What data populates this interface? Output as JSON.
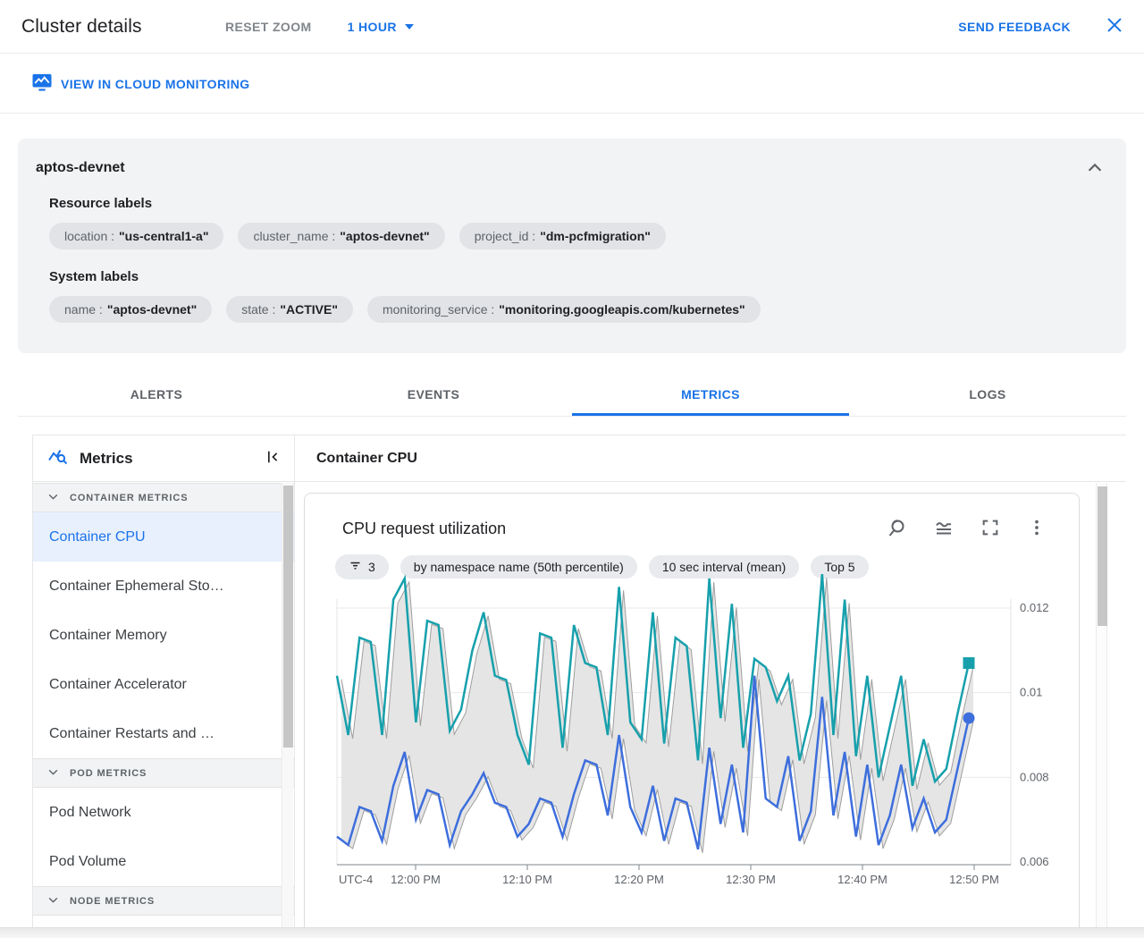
{
  "header": {
    "title": "Cluster details",
    "reset_zoom_label": "RESET ZOOM",
    "time_range_label": "1 HOUR",
    "send_feedback_label": "SEND FEEDBACK"
  },
  "toolbar": {
    "view_in_monitoring_label": "VIEW IN CLOUD MONITORING"
  },
  "cluster_panel": {
    "name": "aptos-devnet",
    "resource_labels_title": "Resource labels",
    "resource_labels": [
      {
        "key": "location :",
        "value": "\"us-central1-a\""
      },
      {
        "key": "cluster_name :",
        "value": "\"aptos-devnet\""
      },
      {
        "key": "project_id :",
        "value": "\"dm-pcfmigration\""
      }
    ],
    "system_labels_title": "System labels",
    "system_labels": [
      {
        "key": "name :",
        "value": "\"aptos-devnet\""
      },
      {
        "key": "state :",
        "value": "\"ACTIVE\""
      },
      {
        "key": "monitoring_service :",
        "value": "\"monitoring.googleapis.com/kubernetes\""
      }
    ]
  },
  "tabs": [
    {
      "label": "ALERTS",
      "active": false
    },
    {
      "label": "EVENTS",
      "active": false
    },
    {
      "label": "METRICS",
      "active": true
    },
    {
      "label": "LOGS",
      "active": false
    }
  ],
  "sidebar": {
    "title": "Metrics",
    "groups": [
      {
        "header": "CONTAINER METRICS",
        "items": [
          {
            "label": "Container CPU",
            "selected": true
          },
          {
            "label": "Container Ephemeral Sto…",
            "selected": false
          },
          {
            "label": "Container Memory",
            "selected": false
          },
          {
            "label": "Container Accelerator",
            "selected": false
          },
          {
            "label": "Container Restarts and …",
            "selected": false
          }
        ]
      },
      {
        "header": "POD METRICS",
        "items": [
          {
            "label": "Pod Network",
            "selected": false
          },
          {
            "label": "Pod Volume",
            "selected": false
          }
        ]
      },
      {
        "header": "NODE METRICS",
        "items": []
      }
    ]
  },
  "main": {
    "section_title": "Container CPU"
  },
  "chart_card": {
    "title": "CPU request utilization",
    "filter_count": "3",
    "chips": [
      "by namespace name (50th percentile)",
      "10 sec interval (mean)",
      "Top 5"
    ]
  },
  "colors": {
    "accent": "#1A73E8",
    "series_teal": "#17A0AC",
    "series_blue": "#3D6EDC",
    "band_fill": "#E5E5E5",
    "band_stroke": "#9E9E9E",
    "grid": "#E8EAED",
    "axis": "#80868B"
  },
  "icons": {
    "monitoring-chart-icon": "monitor with waveform",
    "metrics-search-icon": "zigzag line with magnifier",
    "collapse-panel-icon": "bar with left chevron",
    "chevron-down-icon": "v chevron",
    "chevron-up-icon": "^ chevron",
    "filter-icon": "tapered filter lines",
    "zoom-reset-icon": "magnifier",
    "chart-options-icon": "wave over lines",
    "fullscreen-icon": "corner brackets",
    "more-vert-icon": "kebab dots",
    "close-icon": "x"
  },
  "chart_data": {
    "type": "line",
    "title": "CPU request utilization",
    "timezone_label": "UTC-4",
    "x_tick_labels": [
      "12:00 PM",
      "12:10 PM",
      "12:20 PM",
      "12:30 PM",
      "12:40 PM",
      "12:50 PM"
    ],
    "y_ticks": [
      0.006,
      0.008,
      0.01,
      0.012
    ],
    "y_tick_labels": [
      "0.006",
      "0.008",
      "0.01",
      "0.012"
    ],
    "ylim": [
      0.006,
      0.0129
    ],
    "grid": true,
    "legend": false,
    "series": [
      {
        "id": "series-teal-50th-percentile",
        "color": "#17A0AC",
        "marker": "square",
        "values": [
          0.0104,
          0.009,
          0.0113,
          0.0112,
          0.009,
          0.0122,
          0.0127,
          0.0093,
          0.0117,
          0.0116,
          0.0091,
          0.0096,
          0.011,
          0.0119,
          0.0104,
          0.0103,
          0.009,
          0.0083,
          0.0114,
          0.0113,
          0.0087,
          0.0116,
          0.0107,
          0.0106,
          0.009,
          0.0125,
          0.0093,
          0.0089,
          0.0119,
          0.0088,
          0.0113,
          0.0111,
          0.0084,
          0.0127,
          0.0094,
          0.0121,
          0.0087,
          0.0108,
          0.0106,
          0.0098,
          0.0104,
          0.0084,
          0.0095,
          0.0128,
          0.009,
          0.0122,
          0.0085,
          0.0104,
          0.008,
          0.0092,
          0.0104,
          0.0078,
          0.0089,
          0.0079,
          0.0082,
          0.0095,
          0.0107
        ]
      },
      {
        "id": "series-blue-50th-percentile",
        "color": "#3D6EDC",
        "marker": "circle",
        "values": [
          0.0066,
          0.0064,
          0.0073,
          0.0072,
          0.0065,
          0.0078,
          0.0086,
          0.007,
          0.0077,
          0.0076,
          0.0064,
          0.0072,
          0.0076,
          0.0081,
          0.0074,
          0.0073,
          0.0066,
          0.0069,
          0.0075,
          0.0074,
          0.0066,
          0.0076,
          0.0084,
          0.0083,
          0.0071,
          0.009,
          0.0073,
          0.0067,
          0.0078,
          0.0065,
          0.0075,
          0.0074,
          0.0063,
          0.0087,
          0.0069,
          0.0083,
          0.0067,
          0.0104,
          0.0075,
          0.0073,
          0.0085,
          0.0065,
          0.0072,
          0.0099,
          0.0071,
          0.0086,
          0.0066,
          0.0083,
          0.0064,
          0.0071,
          0.0083,
          0.0068,
          0.0075,
          0.0067,
          0.007,
          0.0082,
          0.0094
        ]
      },
      {
        "id": "series-range-band",
        "type": "band",
        "fill": "#E5E5E5",
        "stroke": "#9E9E9E",
        "between": [
          "series-teal-50th-percentile",
          "series-blue-50th-percentile"
        ]
      }
    ]
  }
}
